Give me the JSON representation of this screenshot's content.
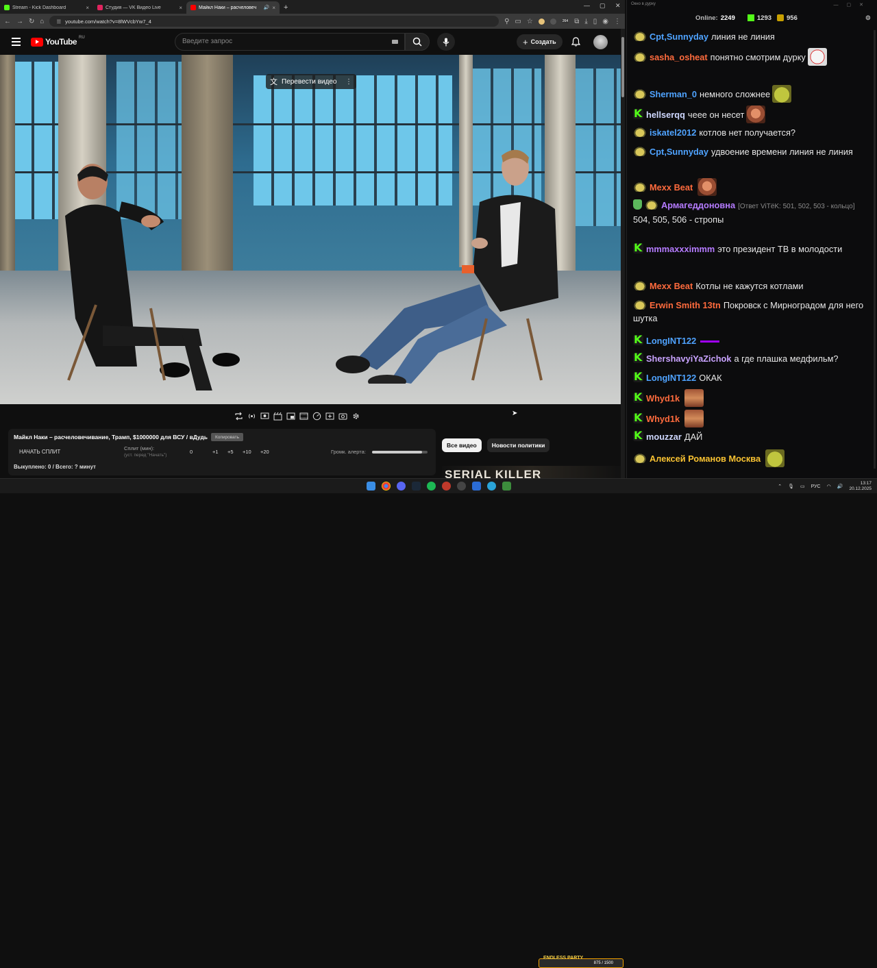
{
  "browser": {
    "tabs": [
      {
        "title": "Stream - Kick Dashboard",
        "color": "#53fc18",
        "active": false
      },
      {
        "title": "Студия — VK Видео Live",
        "color": "#e0245e",
        "active": false
      },
      {
        "title": "Майкл Наки – расчеловеч",
        "color": "#ff0000",
        "active": true
      }
    ],
    "url": "youtube.com/watch?v=8lWVcbYw7_4",
    "ext_badge": "264"
  },
  "youtube": {
    "logo_text": "YouTube",
    "country": "RU",
    "search_placeholder": "Введите запрос",
    "create_label": "Создать",
    "translate_label": "Перевести видео"
  },
  "panel": {
    "title": "Майкл Наки – расчеловечивание, Трамп, $1000000 для ВСУ / вДудь",
    "copy_label": "Копировать",
    "start_split": "НАЧАТЬ СПЛИТ",
    "split_label": "Сплит (мин):",
    "split_hint": "(уст. перед \"Начать\")",
    "split_value": "0",
    "split_buttons": [
      "+1",
      "+5",
      "+10",
      "+20"
    ],
    "alert_label": "Громк. алерта:",
    "alert_volume": 0.9,
    "bought": "Выкуплено: 0 / Всего: ? минут"
  },
  "chips": [
    {
      "label": "Все видео",
      "selected": true
    },
    {
      "label": "Новости политики",
      "selected": false
    }
  ],
  "thumbnail_text": "SERIAL KILLER",
  "chat": {
    "window_title": "Окно в дурку",
    "online_label": "Online:",
    "online_count": "2249",
    "kick_count": "1293",
    "coin_count": "956",
    "messages": [
      {
        "icon": "frog",
        "name": "Cpt,Sunnyday",
        "color": "#4fa3ff",
        "text": "линия не линия",
        "emote": ""
      },
      {
        "icon": "frog",
        "name": "sasha_osheat",
        "color": "#ff6b3d",
        "text": "понятно смотрим дурку",
        "emote": "clown"
      },
      {
        "icon": "frog",
        "name": "Sherman_0",
        "color": "#4fa3ff",
        "text": "немного сложнее",
        "emote": "pepe"
      },
      {
        "icon": "k",
        "name": "hellserqq",
        "color": "#cfd8ff",
        "text": "чеее он несет",
        "emote": "face"
      },
      {
        "icon": "frog",
        "name": "iskatel2012",
        "color": "#4fa3ff",
        "text": "котлов нет получается?",
        "emote": ""
      },
      {
        "icon": "frog",
        "name": "Cpt,Sunnyday",
        "color": "#4fa3ff",
        "text": "удвоение времени линия не линия",
        "emote": ""
      },
      {
        "icon": "frog",
        "name": "Mexx Beat",
        "color": "#ff6b3d",
        "text": "",
        "emote": "face"
      },
      {
        "icon": "shield",
        "name": "Армагеддоновна",
        "color": "#b57bff",
        "reply": "[Ответ ViTёK: 501, 502, 503 - кольцо]",
        "text": "504, 505, 506 - стропы",
        "emote": ""
      },
      {
        "icon": "k",
        "name": "mmmaxxximmm",
        "color": "#b57bff",
        "text": "это президент ТВ в молодости",
        "emote": ""
      },
      {
        "icon": "frog",
        "name": "Mexx Beat",
        "color": "#ff6b3d",
        "text": "Котлы не кажутся котлами",
        "emote": ""
      },
      {
        "icon": "frog",
        "name": "Erwin Smith 13tn",
        "color": "#ff6b3d",
        "text": "Покровск с Мирноградом для него шутка",
        "emote": ""
      },
      {
        "icon": "k",
        "name": "LongINT122",
        "color": "#4fa3ff",
        "text": "",
        "emote": "bar"
      },
      {
        "icon": "k",
        "name": "ShershavyiYaZichok",
        "color": "#c9a3ff",
        "text": "а где плашка медфильм?",
        "emote": ""
      },
      {
        "icon": "k",
        "name": "LongINT122",
        "color": "#4fa3ff",
        "text": "ОКАК",
        "emote": ""
      },
      {
        "icon": "k",
        "name": "Whyd1k",
        "color": "#ff6b3d",
        "text": "",
        "emote": "chad"
      },
      {
        "icon": "k",
        "name": "Whyd1k",
        "color": "#ff6b3d",
        "text": "",
        "emote": "chad"
      },
      {
        "icon": "k",
        "name": "mouzzar",
        "color": "#cfd8ff",
        "text": "ДАЙ",
        "emote": ""
      },
      {
        "icon": "frog",
        "name": "Алексей Романов Москва",
        "color": "#f8c232",
        "text": "",
        "emote": "pepe"
      }
    ]
  },
  "taskbar": {
    "badge_name": "ENDLESS PARTY",
    "badge_progress": "875 / 1500",
    "lang": "РУС",
    "time": "13:17",
    "date": "20.12.2025"
  }
}
